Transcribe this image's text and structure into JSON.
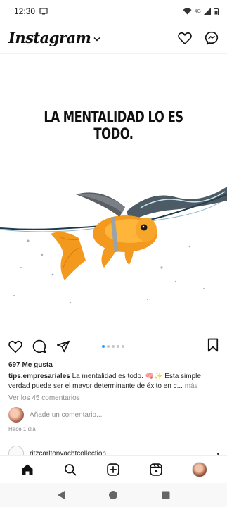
{
  "status_bar": {
    "time": "12:30",
    "network": "4G"
  },
  "header": {
    "logo": "Instagram"
  },
  "post": {
    "headline": "LA MENTALIDAD LO ES TODO.",
    "likes": "697 Me gusta",
    "username": "tips.empresariales",
    "caption": " La mentalidad es todo. 🧠✨ Esta simple verdad puede ser el mayor determinante de éxito en c... ",
    "more": "más",
    "view_comments": "Ver los 45 comentarios",
    "add_comment_placeholder": "Añade un comentario...",
    "time_ago": "Hace 1 día",
    "carousel": {
      "total": 5,
      "active": 0
    }
  },
  "next_post": {
    "username": "ritzcarltonyachtcollection"
  },
  "colors": {
    "accent": "#3897f0",
    "text": "#262626",
    "muted": "#8e8e8e",
    "fish": "#f39a1e",
    "fin": "#6b6e73"
  },
  "icons": {
    "header": [
      "heart-icon",
      "messenger-icon"
    ],
    "actions": [
      "heart-icon",
      "comment-icon",
      "share-icon",
      "bookmark-icon"
    ],
    "bottom_nav": [
      "home-icon",
      "search-icon",
      "create-icon",
      "reels-icon",
      "profile-avatar"
    ],
    "system_nav": [
      "back-icon",
      "home-circle-icon",
      "recents-icon"
    ]
  }
}
